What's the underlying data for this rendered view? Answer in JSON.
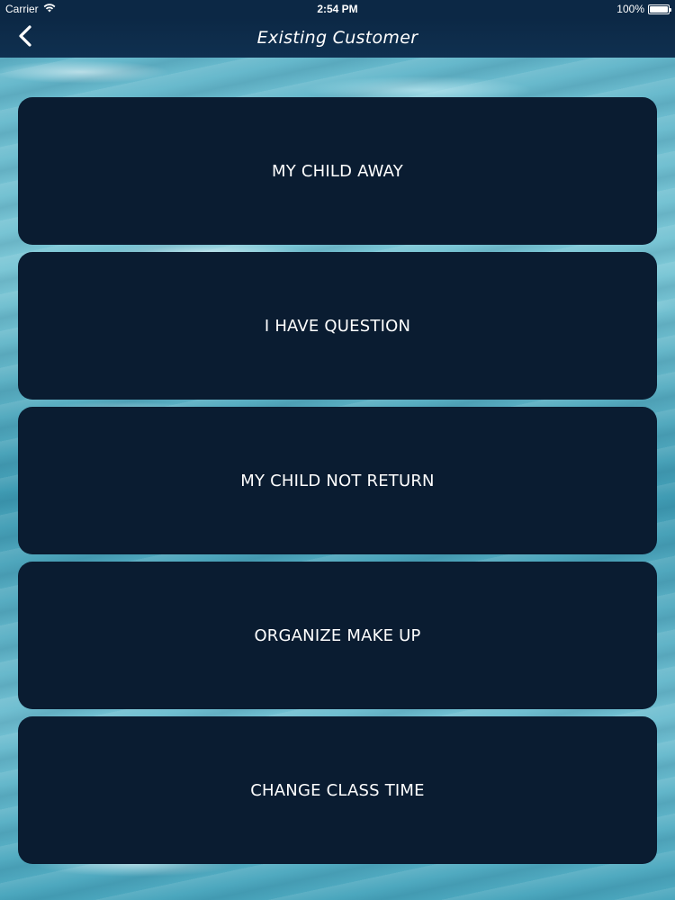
{
  "status_bar": {
    "carrier": "Carrier",
    "time": "2:54 PM",
    "battery": "100%",
    "battery_level": 1.0,
    "wifi_icon": "wifi-icon",
    "battery_icon": "battery-icon"
  },
  "nav": {
    "title": "Existing Customer",
    "back_icon": "chevron-left-icon"
  },
  "menu": {
    "items": [
      {
        "label": "MY CHILD AWAY"
      },
      {
        "label": "I HAVE QUESTION"
      },
      {
        "label": "MY CHILD NOT RETURN"
      },
      {
        "label": "ORGANIZE MAKE UP"
      },
      {
        "label": "CHANGE CLASS TIME"
      }
    ]
  },
  "colors": {
    "nav_background": "#0c2845",
    "button_background": "#0a1c31",
    "text": "#ffffff"
  }
}
